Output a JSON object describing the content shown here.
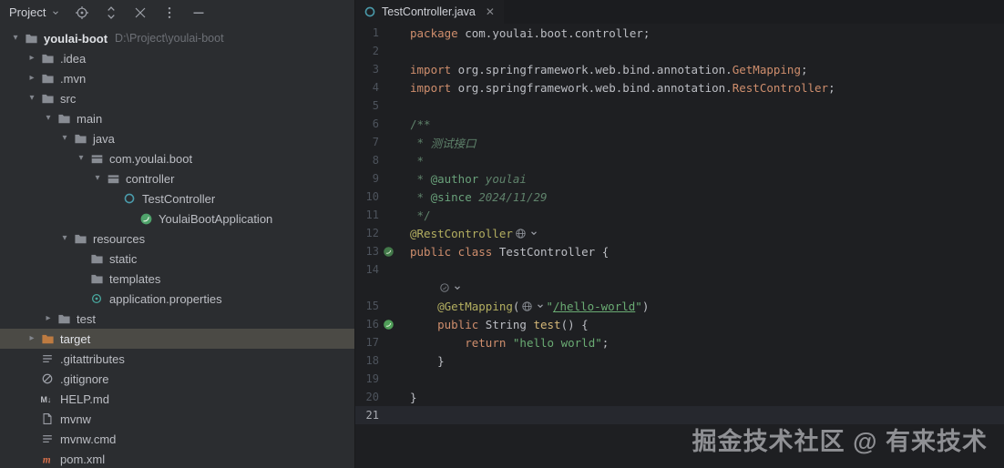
{
  "watermark": "掘金技术社区 @ 有来技术",
  "colors": {
    "panel_bg": "#2b2d30",
    "editor_bg": "#1e1f22",
    "selection_bg": "#4b4a45",
    "keyword": "#cf8e6d",
    "string": "#6aab73",
    "doc_comment": "#5f826b",
    "annotation": "#b3ae60",
    "spring_green": "#4fa36b"
  },
  "project_panel": {
    "title": "Project",
    "toolbar_icons": [
      "locate-target",
      "sort-updown",
      "collapse-all",
      "more-options",
      "hide-panel"
    ],
    "tree": [
      {
        "label": "youlai-boot",
        "suffix": "D:\\Project\\youlai-boot",
        "indent": 0,
        "chevron": "down",
        "icon": "folder",
        "bold": true
      },
      {
        "label": ".idea",
        "indent": 1,
        "chevron": "right",
        "icon": "folder"
      },
      {
        "label": ".mvn",
        "indent": 1,
        "chevron": "right",
        "icon": "folder"
      },
      {
        "label": "src",
        "indent": 1,
        "chevron": "down",
        "icon": "folder"
      },
      {
        "label": "main",
        "indent": 2,
        "chevron": "down",
        "icon": "folder"
      },
      {
        "label": "java",
        "indent": 3,
        "chevron": "down",
        "icon": "folder"
      },
      {
        "label": "com.youlai.boot",
        "indent": 4,
        "chevron": "down",
        "icon": "package"
      },
      {
        "label": "controller",
        "indent": 5,
        "chevron": "down",
        "icon": "package"
      },
      {
        "label": "TestController",
        "indent": 6,
        "chevron": "none",
        "icon": "class"
      },
      {
        "label": "YoulaiBootApplication",
        "indent": 7,
        "chevron": "none",
        "icon": "spring"
      },
      {
        "label": "resources",
        "indent": 3,
        "chevron": "down",
        "icon": "folder"
      },
      {
        "label": "static",
        "indent": 4,
        "chevron": "none",
        "icon": "folder"
      },
      {
        "label": "templates",
        "indent": 4,
        "chevron": "none",
        "icon": "folder"
      },
      {
        "label": "application.properties",
        "indent": 4,
        "chevron": "none",
        "icon": "properties"
      },
      {
        "label": "test",
        "indent": 2,
        "chevron": "right",
        "icon": "folder"
      },
      {
        "label": "target",
        "indent": 1,
        "chevron": "right",
        "icon": "folderex",
        "selected": true
      },
      {
        "label": ".gitattributes",
        "indent": 1,
        "chevron": "none",
        "icon": "lines"
      },
      {
        "label": ".gitignore",
        "indent": 1,
        "chevron": "none",
        "icon": "ignore"
      },
      {
        "label": "HELP.md",
        "indent": 1,
        "chevron": "none",
        "icon": "markdown"
      },
      {
        "label": "mvnw",
        "indent": 1,
        "chevron": "none",
        "icon": "file"
      },
      {
        "label": "mvnw.cmd",
        "indent": 1,
        "chevron": "none",
        "icon": "lines"
      },
      {
        "label": "pom.xml",
        "indent": 1,
        "chevron": "none",
        "icon": "maven"
      }
    ]
  },
  "editor": {
    "tab": {
      "label": "TestController.java",
      "icon": "class",
      "close": "✕"
    },
    "code": {
      "rows": [
        {
          "n": "1",
          "seg": [
            {
              "t": "package",
              "c": "kw"
            },
            {
              "t": " com.youlai.boot.controller;",
              "c": "pl"
            }
          ]
        },
        {
          "n": "2",
          "seg": []
        },
        {
          "n": "3",
          "seg": [
            {
              "t": "import",
              "c": "kw"
            },
            {
              "t": " org.springframework.web.bind.annotation.",
              "c": "pl"
            },
            {
              "t": "GetMapping",
              "c": "kw"
            },
            {
              "t": ";",
              "c": "pl"
            }
          ]
        },
        {
          "n": "4",
          "seg": [
            {
              "t": "import",
              "c": "kw"
            },
            {
              "t": " org.springframework.web.bind.annotation.",
              "c": "pl"
            },
            {
              "t": "RestController",
              "c": "kw"
            },
            {
              "t": ";",
              "c": "pl"
            }
          ]
        },
        {
          "n": "5",
          "seg": []
        },
        {
          "n": "6",
          "seg": [
            {
              "t": "/**",
              "c": "doc"
            }
          ]
        },
        {
          "n": "7",
          "seg": [
            {
              "t": " * ",
              "c": "doc"
            },
            {
              "t": "测试接口",
              "c": "docit"
            }
          ]
        },
        {
          "n": "8",
          "seg": [
            {
              "t": " *",
              "c": "doc"
            }
          ]
        },
        {
          "n": "9",
          "seg": [
            {
              "t": " * ",
              "c": "doc"
            },
            {
              "t": "@author",
              "c": "doctag"
            },
            {
              "t": " youlai",
              "c": "docit"
            }
          ]
        },
        {
          "n": "10",
          "seg": [
            {
              "t": " * ",
              "c": "doc"
            },
            {
              "t": "@since",
              "c": "doctag"
            },
            {
              "t": " 2024/11/29",
              "c": "docit"
            }
          ]
        },
        {
          "n": "11",
          "seg": [
            {
              "t": " */",
              "c": "doc"
            }
          ]
        },
        {
          "n": "12",
          "seg": [
            {
              "t": "@RestController",
              "c": "ann"
            },
            {
              "ic": "globe"
            },
            {
              "ic": "minichevron"
            }
          ]
        },
        {
          "n": "13",
          "g": "bean",
          "seg": [
            {
              "t": "public class",
              "c": "kw"
            },
            {
              "t": " TestController {",
              "c": "pl"
            }
          ]
        },
        {
          "n": "14",
          "seg": []
        },
        {
          "inlay": true,
          "seg": [
            {
              "t": "    ",
              "c": "pl"
            },
            {
              "ic": "springinlay"
            },
            {
              "ic": "minichevron"
            }
          ]
        },
        {
          "n": "15",
          "seg": [
            {
              "t": "    ",
              "c": "pl"
            },
            {
              "t": "@GetMapping",
              "c": "ann"
            },
            {
              "t": "(",
              "c": "pl"
            },
            {
              "ic": "globe"
            },
            {
              "ic": "minichevron"
            },
            {
              "t": "\"",
              "c": "str"
            },
            {
              "t": "/hello-world",
              "c": "strlink"
            },
            {
              "t": "\"",
              "c": "str"
            },
            {
              "t": ")",
              "c": "pl"
            }
          ]
        },
        {
          "n": "16",
          "g": "endpoint",
          "seg": [
            {
              "t": "    ",
              "c": "pl"
            },
            {
              "t": "public",
              "c": "kw"
            },
            {
              "t": " String ",
              "c": "pl"
            },
            {
              "t": "test",
              "c": "mth"
            },
            {
              "t": "() {",
              "c": "pl"
            }
          ]
        },
        {
          "n": "17",
          "seg": [
            {
              "t": "        ",
              "c": "pl"
            },
            {
              "t": "return",
              "c": "kw"
            },
            {
              "t": " ",
              "c": "pl"
            },
            {
              "t": "\"hello world\"",
              "c": "str"
            },
            {
              "t": ";",
              "c": "pl"
            }
          ]
        },
        {
          "n": "18",
          "seg": [
            {
              "t": "    }",
              "c": "pl"
            }
          ]
        },
        {
          "n": "19",
          "seg": []
        },
        {
          "n": "20",
          "seg": [
            {
              "t": "}",
              "c": "pl"
            }
          ]
        },
        {
          "n": "21",
          "caret": true,
          "seg": []
        }
      ]
    }
  }
}
